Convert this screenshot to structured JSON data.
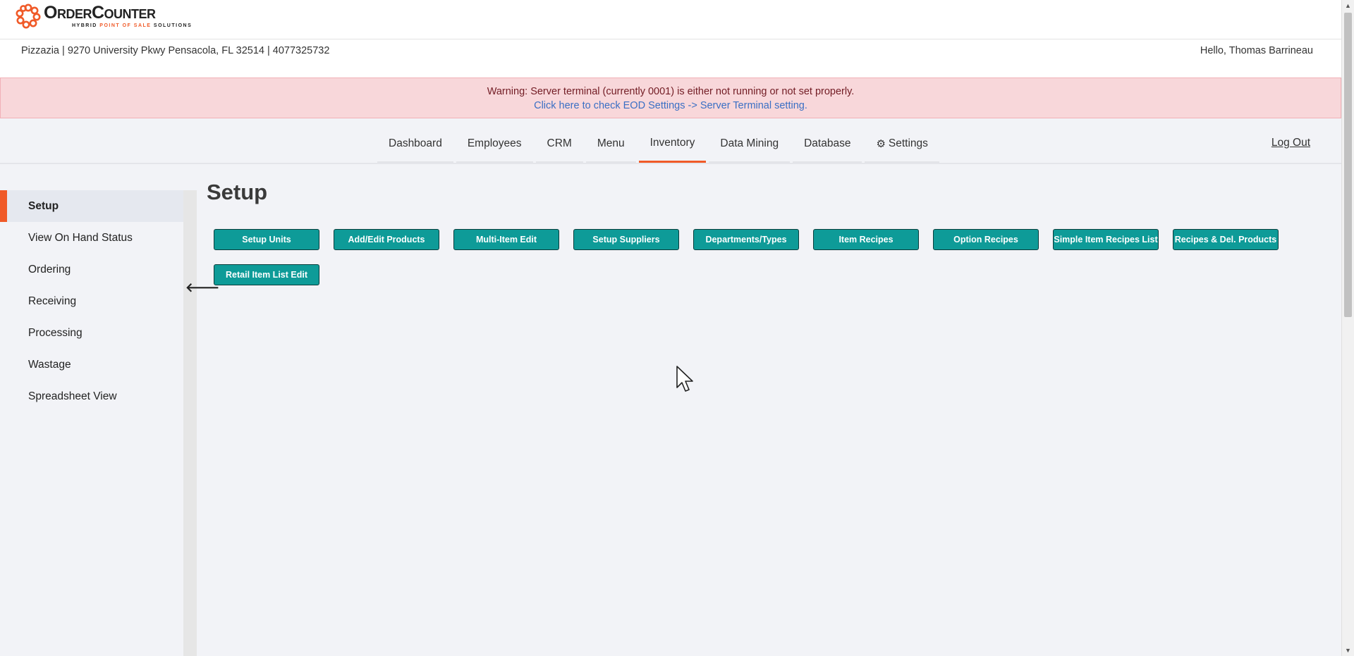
{
  "brand": {
    "name": "OrderCounter",
    "tagline_prefix": "HYBRID ",
    "tagline_accent": "POINT OF SALE",
    "tagline_suffix": " SOLUTIONS",
    "accent_color": "#f05a28"
  },
  "header": {
    "store_info": "Pizzazia | 9270 University Pkwy Pensacola, FL 32514 | 4077325732",
    "greeting": "Hello, Thomas Barrineau"
  },
  "warning": {
    "message": "Warning: Server terminal (currently 0001) is either not running or not set properly.",
    "link_text": "Click here to check EOD Settings -> Server Terminal setting."
  },
  "nav": {
    "items": [
      {
        "label": "Dashboard"
      },
      {
        "label": "Employees"
      },
      {
        "label": "CRM"
      },
      {
        "label": "Menu"
      },
      {
        "label": "Inventory"
      },
      {
        "label": "Data Mining"
      },
      {
        "label": "Database"
      },
      {
        "label": "Settings",
        "icon": "gear-icon"
      }
    ],
    "active": "Inventory",
    "logout": "Log Out"
  },
  "sidebar": {
    "items": [
      {
        "label": "Setup"
      },
      {
        "label": "View On Hand Status"
      },
      {
        "label": "Ordering"
      },
      {
        "label": "Receiving"
      },
      {
        "label": "Processing"
      },
      {
        "label": "Wastage"
      },
      {
        "label": "Spreadsheet View"
      }
    ],
    "active": "Setup",
    "collapse_icon": "arrow-left-icon"
  },
  "main": {
    "title": "Setup",
    "buttons": [
      {
        "label": "Setup Units"
      },
      {
        "label": "Add/Edit Products"
      },
      {
        "label": "Multi-Item Edit"
      },
      {
        "label": "Setup Suppliers"
      },
      {
        "label": "Departments/Types"
      },
      {
        "label": "Item Recipes"
      },
      {
        "label": "Option Recipes"
      },
      {
        "label": "Simple Item Recipes List"
      },
      {
        "label": "Recipes & Del. Products"
      },
      {
        "label": "Retail Item List Edit"
      }
    ],
    "button_color": "#0e9b98"
  }
}
